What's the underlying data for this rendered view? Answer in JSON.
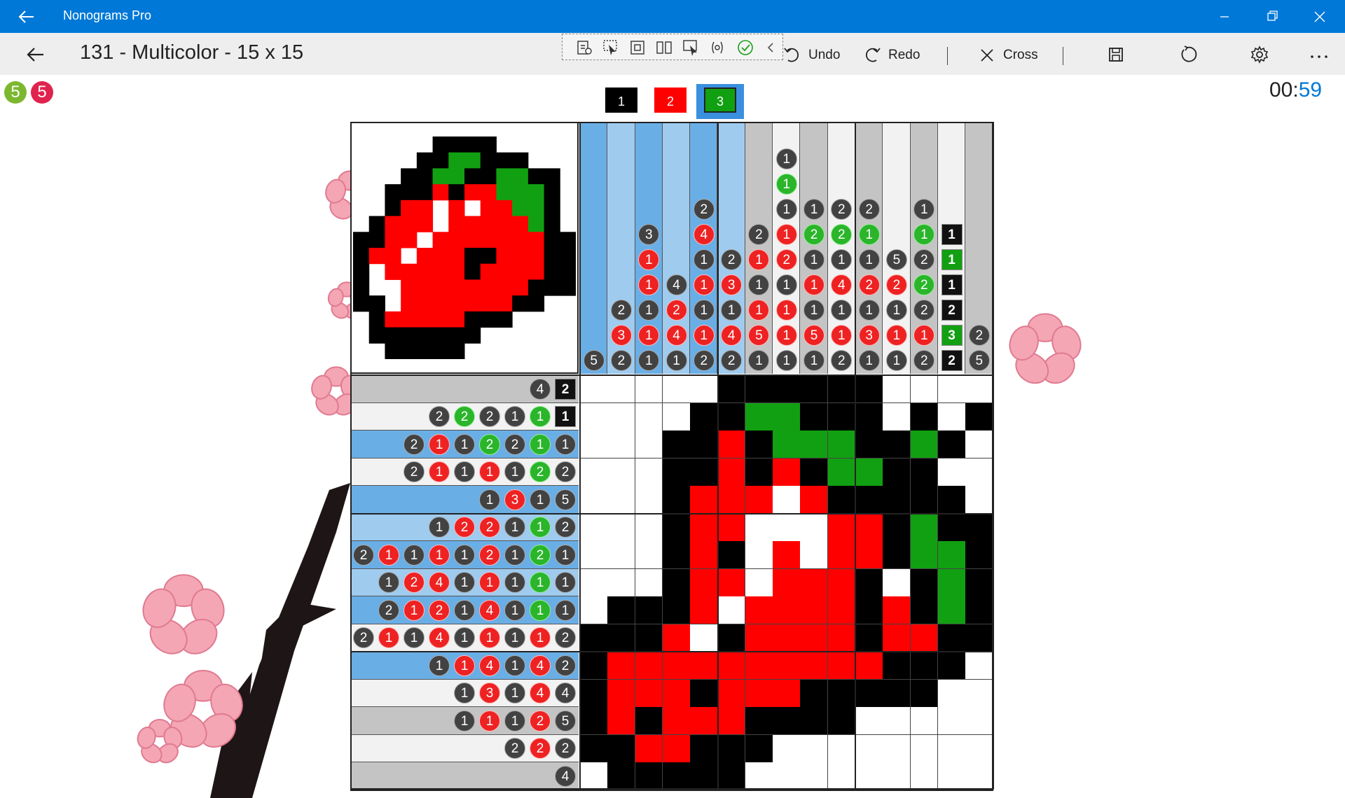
{
  "app": {
    "title": "Nonograms Pro"
  },
  "header": {
    "puzzle_title": "131 - Multicolor - 15 x 15"
  },
  "toolbar": {
    "undo_label": "Undo",
    "redo_label": "Redo",
    "cross_label": "Cross",
    "icons": [
      "save-icon",
      "restart-icon",
      "settings-icon",
      "more-icon"
    ]
  },
  "status": {
    "badges": [
      {
        "value": "5",
        "color": "#7cb82f"
      },
      {
        "value": "5",
        "color": "#e0234e"
      }
    ],
    "timer_minutes": "00:",
    "timer_seconds": "59"
  },
  "palette": [
    {
      "label": "1",
      "color": "#000000",
      "selected": false
    },
    {
      "label": "2",
      "color": "#ff0000",
      "selected": false
    },
    {
      "label": "3",
      "color": "#11a011",
      "selected": true
    }
  ],
  "colors": {
    "1": "#000000",
    "2": "#ff0000",
    "3": "#11a011",
    "accent": "#0078d7",
    "highlight_dark": "#6aaee6",
    "highlight_light": "#9fcbef",
    "shade_gray": "#c4c4c4",
    "shade_light": "#f2f2f2"
  },
  "puzzle": {
    "size": 15,
    "column_clues": [
      [
        [
          5,
          1
        ]
      ],
      [
        [
          2,
          1
        ],
        [
          3,
          2
        ],
        [
          2,
          1
        ]
      ],
      [
        [
          3,
          1
        ],
        [
          1,
          2
        ],
        [
          1,
          2
        ],
        [
          1,
          1
        ],
        [
          1,
          2
        ],
        [
          1,
          1
        ]
      ],
      [
        [
          4,
          1
        ],
        [
          2,
          2
        ],
        [
          4,
          2
        ],
        [
          1,
          1
        ]
      ],
      [
        [
          2,
          1
        ],
        [
          4,
          2
        ],
        [
          1,
          1
        ],
        [
          1,
          2
        ],
        [
          1,
          1
        ],
        [
          1,
          2
        ],
        [
          2,
          1
        ]
      ],
      [
        [
          2,
          1
        ],
        [
          3,
          2
        ],
        [
          1,
          1
        ],
        [
          4,
          2
        ],
        [
          2,
          1
        ]
      ],
      [
        [
          2,
          1
        ],
        [
          1,
          2
        ],
        [
          1,
          1
        ],
        [
          1,
          2
        ],
        [
          5,
          2
        ],
        [
          1,
          1
        ]
      ],
      [
        [
          1,
          1
        ],
        [
          1,
          3
        ],
        [
          1,
          1
        ],
        [
          1,
          2
        ],
        [
          2,
          2
        ],
        [
          1,
          1
        ],
        [
          1,
          2
        ],
        [
          1,
          2
        ],
        [
          1,
          1
        ]
      ],
      [
        [
          1,
          1
        ],
        [
          2,
          3
        ],
        [
          1,
          1
        ],
        [
          1,
          2
        ],
        [
          1,
          1
        ],
        [
          5,
          2
        ],
        [
          1,
          1
        ]
      ],
      [
        [
          2,
          1
        ],
        [
          2,
          3
        ],
        [
          1,
          1
        ],
        [
          4,
          2
        ],
        [
          1,
          1
        ],
        [
          1,
          2
        ],
        [
          2,
          1
        ]
      ],
      [
        [
          2,
          1
        ],
        [
          1,
          3
        ],
        [
          1,
          1
        ],
        [
          2,
          2
        ],
        [
          1,
          1
        ],
        [
          3,
          2
        ],
        [
          1,
          1
        ]
      ],
      [
        [
          5,
          1
        ],
        [
          2,
          2
        ],
        [
          1,
          1
        ],
        [
          1,
          2
        ],
        [
          1,
          1
        ]
      ],
      [
        [
          1,
          1
        ],
        [
          1,
          3
        ],
        [
          2,
          1
        ],
        [
          2,
          3
        ],
        [
          2,
          1
        ],
        [
          1,
          2
        ],
        [
          2,
          1
        ]
      ],
      [
        [
          1,
          1
        ],
        [
          1,
          3
        ],
        [
          1,
          1
        ],
        [
          2,
          1
        ],
        [
          3,
          3
        ],
        [
          2,
          1
        ]
      ],
      [
        [
          2,
          1
        ],
        [
          5,
          1
        ]
      ]
    ],
    "row_clues": [
      [
        [
          4,
          1
        ],
        [
          2,
          1
        ]
      ],
      [
        [
          2,
          1
        ],
        [
          2,
          3
        ],
        [
          2,
          1
        ],
        [
          1,
          1
        ],
        [
          1,
          3
        ],
        [
          1,
          1
        ]
      ],
      [
        [
          2,
          1
        ],
        [
          1,
          2
        ],
        [
          1,
          1
        ],
        [
          2,
          3
        ],
        [
          2,
          1
        ],
        [
          1,
          3
        ],
        [
          1,
          1
        ]
      ],
      [
        [
          2,
          1
        ],
        [
          1,
          2
        ],
        [
          1,
          1
        ],
        [
          1,
          2
        ],
        [
          1,
          1
        ],
        [
          2,
          3
        ],
        [
          2,
          1
        ]
      ],
      [
        [
          1,
          1
        ],
        [
          3,
          2
        ],
        [
          1,
          1
        ],
        [
          5,
          1
        ]
      ],
      [
        [
          1,
          1
        ],
        [
          2,
          2
        ],
        [
          2,
          2
        ],
        [
          1,
          1
        ],
        [
          1,
          3
        ],
        [
          2,
          1
        ]
      ],
      [
        [
          2,
          1
        ],
        [
          1,
          2
        ],
        [
          1,
          1
        ],
        [
          1,
          2
        ],
        [
          1,
          1
        ],
        [
          2,
          2
        ],
        [
          1,
          1
        ],
        [
          2,
          3
        ],
        [
          1,
          1
        ]
      ],
      [
        [
          1,
          1
        ],
        [
          2,
          2
        ],
        [
          4,
          2
        ],
        [
          1,
          1
        ],
        [
          1,
          2
        ],
        [
          1,
          1
        ],
        [
          1,
          3
        ],
        [
          1,
          1
        ]
      ],
      [
        [
          2,
          1
        ],
        [
          1,
          2
        ],
        [
          2,
          2
        ],
        [
          1,
          1
        ],
        [
          4,
          2
        ],
        [
          1,
          1
        ],
        [
          1,
          3
        ],
        [
          1,
          1
        ]
      ],
      [
        [
          2,
          1
        ],
        [
          1,
          2
        ],
        [
          1,
          1
        ],
        [
          4,
          2
        ],
        [
          1,
          1
        ],
        [
          1,
          2
        ],
        [
          1,
          1
        ],
        [
          1,
          2
        ],
        [
          2,
          1
        ]
      ],
      [
        [
          1,
          1
        ],
        [
          1,
          2
        ],
        [
          4,
          2
        ],
        [
          1,
          1
        ],
        [
          4,
          2
        ],
        [
          2,
          1
        ]
      ],
      [
        [
          1,
          1
        ],
        [
          3,
          2
        ],
        [
          1,
          1
        ],
        [
          4,
          2
        ],
        [
          4,
          1
        ]
      ],
      [
        [
          1,
          1
        ],
        [
          1,
          2
        ],
        [
          1,
          1
        ],
        [
          2,
          2
        ],
        [
          5,
          1
        ]
      ],
      [
        [
          2,
          1
        ],
        [
          2,
          2
        ],
        [
          2,
          1
        ]
      ],
      [
        [
          4,
          1
        ]
      ]
    ],
    "column_shades": [
      "hd",
      "hl",
      "hd",
      "hl",
      "hd",
      "hl",
      "g",
      "l",
      "g",
      "l",
      "g",
      "l",
      "g",
      "l",
      "g"
    ],
    "row_shades": [
      "g",
      "l",
      "hd",
      "l",
      "hd",
      "hl",
      "hd",
      "hl",
      "hd",
      "l",
      "hd",
      "l",
      "g",
      "l",
      "g"
    ],
    "grid": [
      "000001111110000",
      "000011331110101",
      "000112133311310",
      "000112121331100",
      "000122202111110",
      "000122000221311",
      "000121020221331",
      "000122022210131",
      "011120222212131",
      "111201222212211",
      "122222222221110",
      "122212221111100",
      "121222111100000",
      "112211100000000",
      "011111000000000"
    ],
    "preview": [
      "00000111100000",
      "00001133111000",
      "00011331133110",
      "00111212233310",
      "00122020223310",
      "01222022222310",
      "11220222222211",
      "12202221122211",
      "10222221222211",
      "10022222222111",
      "11022222221100",
      "01222221110000",
      "01111111000000",
      "00111110000000"
    ]
  }
}
